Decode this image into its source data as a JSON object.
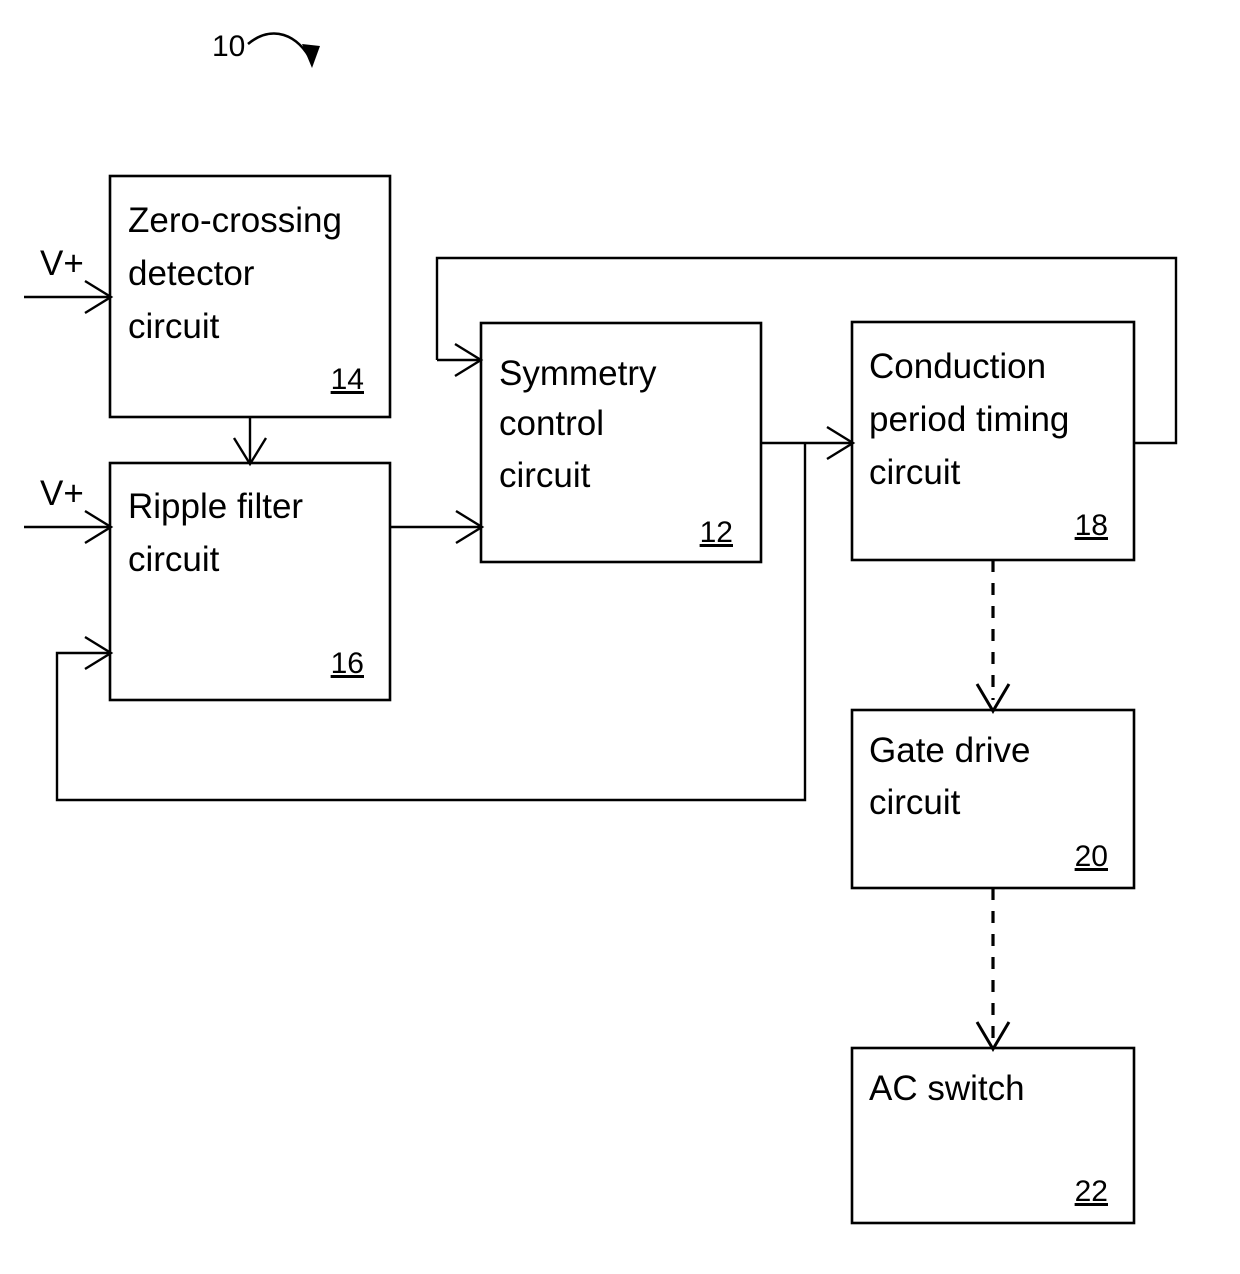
{
  "figure": {
    "reference_number": "10",
    "pointer_icon": "curved-arrow-icon"
  },
  "ports": [
    {
      "id": "v-plus-zero-crossing",
      "label": "V+"
    },
    {
      "id": "v-plus-ripple-filter",
      "label": "V+"
    }
  ],
  "blocks": [
    {
      "id": "zero-crossing-detector",
      "lines": [
        "Zero-crossing",
        "detector",
        "circuit"
      ],
      "ref": "14"
    },
    {
      "id": "ripple-filter",
      "lines": [
        "Ripple filter",
        "circuit"
      ],
      "ref": "16"
    },
    {
      "id": "symmetry-control",
      "lines": [
        "Symmetry",
        "control",
        "circuit"
      ],
      "ref": "12"
    },
    {
      "id": "conduction-period-timing",
      "lines": [
        "Conduction",
        "period timing",
        "circuit"
      ],
      "ref": "18"
    },
    {
      "id": "gate-drive",
      "lines": [
        "Gate drive",
        "circuit"
      ],
      "ref": "20"
    },
    {
      "id": "ac-switch",
      "lines": [
        "AC switch"
      ],
      "ref": "22"
    }
  ],
  "colors": {
    "stroke": "#000000",
    "fill": "#ffffff",
    "text": "#000000"
  }
}
